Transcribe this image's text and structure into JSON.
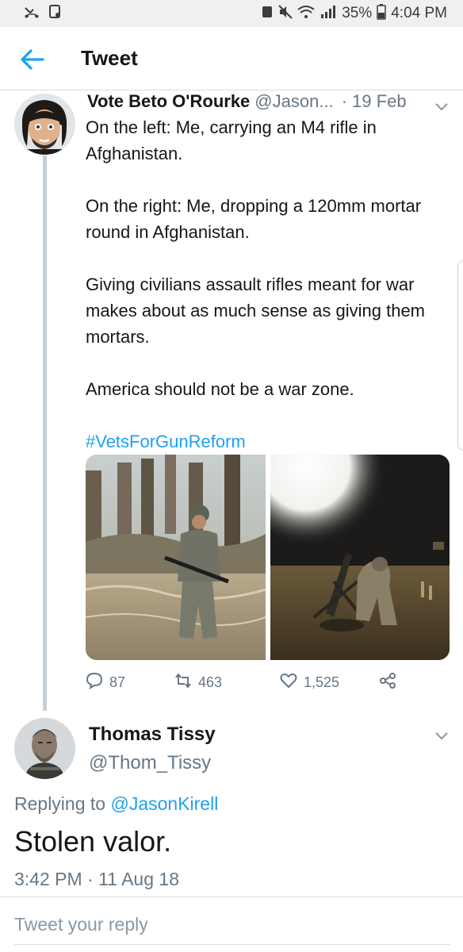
{
  "status_bar": {
    "battery": "35%",
    "time": "4:04 PM"
  },
  "header": {
    "title": "Tweet"
  },
  "parent_tweet": {
    "name": "Vote Beto O'Rourke",
    "handle": "@Jason...",
    "date": "· 19 Feb",
    "paragraphs": [
      "On the left: Me, carrying an M4 rifle in Afghanistan.",
      "On the right: Me, dropping a 120mm mortar round in Afghanistan.",
      "Giving civilians assault rifles meant for war makes about as much sense as giving them mortars.",
      "America should not be a war zone."
    ],
    "hashtag": "#VetsForGunReform",
    "stats": {
      "replies": "87",
      "retweets": "463",
      "likes": "1,525"
    }
  },
  "reply_tweet": {
    "name": "Thomas Tissy",
    "handle": "@Thom_Tissy",
    "replying_to_prefix": "Replying to ",
    "replying_to_handle": "@JasonKirell",
    "text": "Stolen valor.",
    "timestamp": "3:42 PM · 11 Aug 18"
  },
  "compose": {
    "placeholder": "Tweet your reply"
  },
  "colors": {
    "accent": "#1da1f2",
    "muted": "#657786",
    "thread_line": "#c4cfd6"
  }
}
